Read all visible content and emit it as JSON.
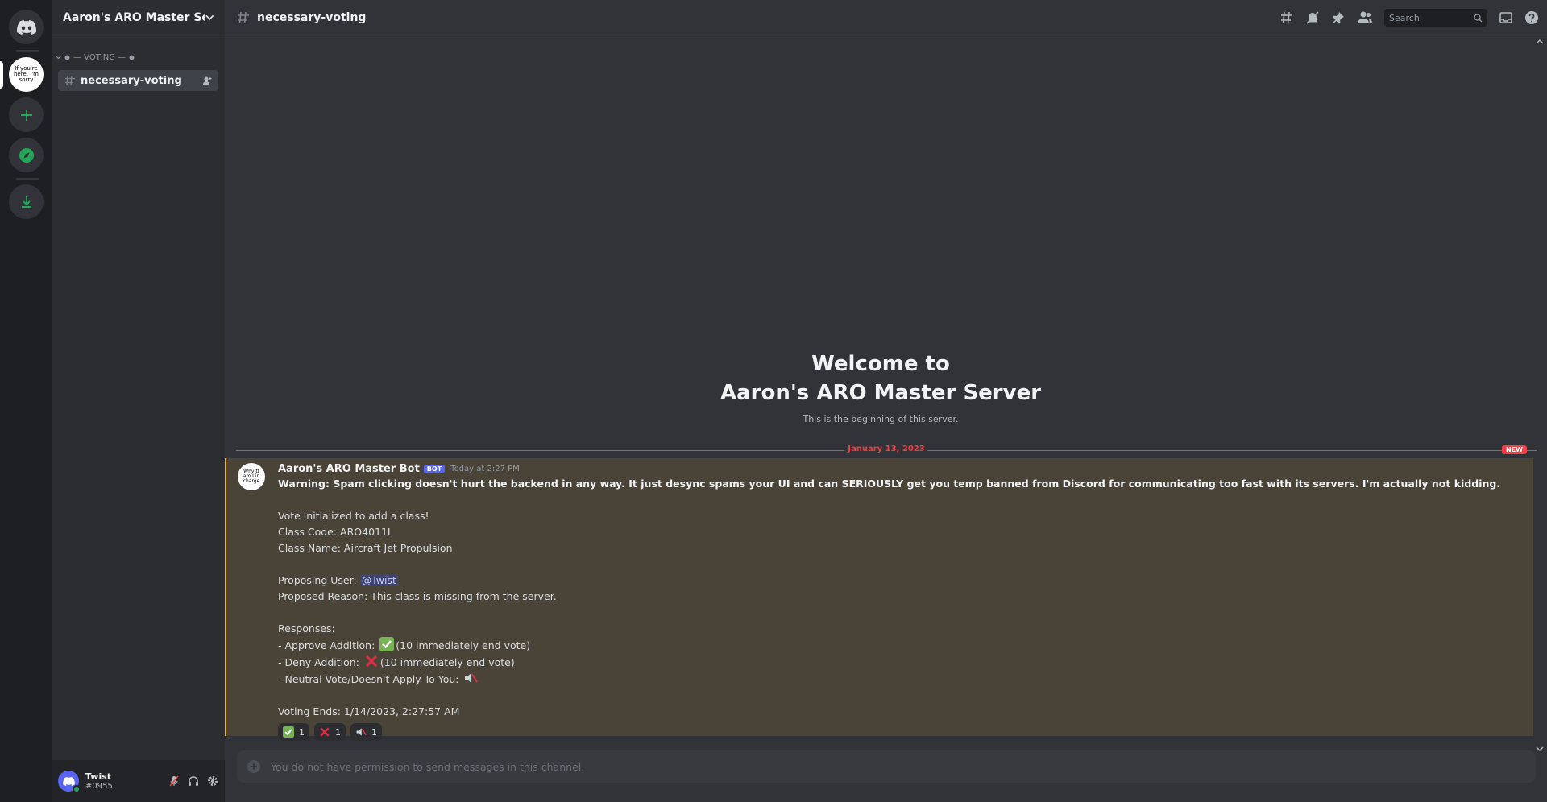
{
  "server": {
    "name": "Aaron's ARO Master Ser...",
    "icon_text": "If you're here, I'm sorry"
  },
  "category": {
    "label": "— VOTING —"
  },
  "channels": [
    {
      "name": "necessary-voting"
    }
  ],
  "header": {
    "channel_name": "necessary-voting",
    "search_placeholder": "Search"
  },
  "welcome": {
    "line1": "Welcome to",
    "line2": "Aaron's ARO Master Server",
    "subtitle": "This is the beginning of this server."
  },
  "divider": {
    "date": "January 13, 2023",
    "new_label": "NEW"
  },
  "message": {
    "author": "Aaron's ARO Master Bot",
    "bot_tag": "BOT",
    "timestamp": "Today at 2:27 PM",
    "avatar_text": "Why tf am I in charge",
    "warning": "Warning: Spam clicking doesn't hurt the backend in any way. It just desync spams your UI and can SERIOUSLY get you temp banned from Discord for communicating too fast with its servers. I'm actually not kidding.",
    "vote_init": "Vote initialized to add a class!",
    "class_code": "Class Code: ARO4011L",
    "class_name": "Class Name: Aircraft Jet Propulsion",
    "proposing_label": "Proposing User: ",
    "mention": "@Twist",
    "reason": "Proposed Reason: This class is missing from the server.",
    "responses_label": "Responses:",
    "approve_pre": "- Approve Addition: ",
    "approve_post": "(10 immediately end vote)",
    "deny_pre": "- Deny Addition: ",
    "deny_post": "(10 immediately end vote)",
    "neutral_pre": "- Neutral Vote/Doesn't Apply To You: ",
    "voting_ends": "Voting Ends: 1/14/2023, 2:27:57 AM",
    "reactions": [
      {
        "emoji": "check-mark-icon",
        "count": "1"
      },
      {
        "emoji": "cross-mark-icon",
        "count": "1"
      },
      {
        "emoji": "muted-speaker-icon",
        "count": "1"
      }
    ]
  },
  "composer": {
    "placeholder": "You do not have permission to send messages in this channel."
  },
  "user": {
    "name": "Twist",
    "tag": "#0955",
    "status_color": "#23a55a"
  },
  "colors": {
    "accent": "#5865f2",
    "highlight_border": "#f0b232",
    "new_red": "#f23f43",
    "green": "#23a55a"
  }
}
